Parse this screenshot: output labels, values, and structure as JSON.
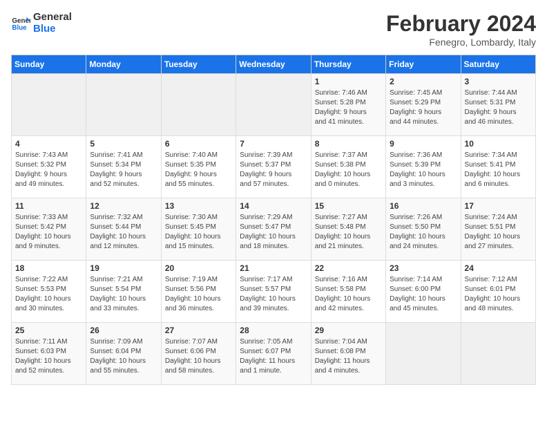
{
  "header": {
    "logo_line1": "General",
    "logo_line2": "Blue",
    "month": "February 2024",
    "location": "Fenegro, Lombardy, Italy"
  },
  "days_of_week": [
    "Sunday",
    "Monday",
    "Tuesday",
    "Wednesday",
    "Thursday",
    "Friday",
    "Saturday"
  ],
  "weeks": [
    [
      {
        "day": "",
        "info": ""
      },
      {
        "day": "",
        "info": ""
      },
      {
        "day": "",
        "info": ""
      },
      {
        "day": "",
        "info": ""
      },
      {
        "day": "1",
        "info": "Sunrise: 7:46 AM\nSunset: 5:28 PM\nDaylight: 9 hours\nand 41 minutes."
      },
      {
        "day": "2",
        "info": "Sunrise: 7:45 AM\nSunset: 5:29 PM\nDaylight: 9 hours\nand 44 minutes."
      },
      {
        "day": "3",
        "info": "Sunrise: 7:44 AM\nSunset: 5:31 PM\nDaylight: 9 hours\nand 46 minutes."
      }
    ],
    [
      {
        "day": "4",
        "info": "Sunrise: 7:43 AM\nSunset: 5:32 PM\nDaylight: 9 hours\nand 49 minutes."
      },
      {
        "day": "5",
        "info": "Sunrise: 7:41 AM\nSunset: 5:34 PM\nDaylight: 9 hours\nand 52 minutes."
      },
      {
        "day": "6",
        "info": "Sunrise: 7:40 AM\nSunset: 5:35 PM\nDaylight: 9 hours\nand 55 minutes."
      },
      {
        "day": "7",
        "info": "Sunrise: 7:39 AM\nSunset: 5:37 PM\nDaylight: 9 hours\nand 57 minutes."
      },
      {
        "day": "8",
        "info": "Sunrise: 7:37 AM\nSunset: 5:38 PM\nDaylight: 10 hours\nand 0 minutes."
      },
      {
        "day": "9",
        "info": "Sunrise: 7:36 AM\nSunset: 5:39 PM\nDaylight: 10 hours\nand 3 minutes."
      },
      {
        "day": "10",
        "info": "Sunrise: 7:34 AM\nSunset: 5:41 PM\nDaylight: 10 hours\nand 6 minutes."
      }
    ],
    [
      {
        "day": "11",
        "info": "Sunrise: 7:33 AM\nSunset: 5:42 PM\nDaylight: 10 hours\nand 9 minutes."
      },
      {
        "day": "12",
        "info": "Sunrise: 7:32 AM\nSunset: 5:44 PM\nDaylight: 10 hours\nand 12 minutes."
      },
      {
        "day": "13",
        "info": "Sunrise: 7:30 AM\nSunset: 5:45 PM\nDaylight: 10 hours\nand 15 minutes."
      },
      {
        "day": "14",
        "info": "Sunrise: 7:29 AM\nSunset: 5:47 PM\nDaylight: 10 hours\nand 18 minutes."
      },
      {
        "day": "15",
        "info": "Sunrise: 7:27 AM\nSunset: 5:48 PM\nDaylight: 10 hours\nand 21 minutes."
      },
      {
        "day": "16",
        "info": "Sunrise: 7:26 AM\nSunset: 5:50 PM\nDaylight: 10 hours\nand 24 minutes."
      },
      {
        "day": "17",
        "info": "Sunrise: 7:24 AM\nSunset: 5:51 PM\nDaylight: 10 hours\nand 27 minutes."
      }
    ],
    [
      {
        "day": "18",
        "info": "Sunrise: 7:22 AM\nSunset: 5:53 PM\nDaylight: 10 hours\nand 30 minutes."
      },
      {
        "day": "19",
        "info": "Sunrise: 7:21 AM\nSunset: 5:54 PM\nDaylight: 10 hours\nand 33 minutes."
      },
      {
        "day": "20",
        "info": "Sunrise: 7:19 AM\nSunset: 5:56 PM\nDaylight: 10 hours\nand 36 minutes."
      },
      {
        "day": "21",
        "info": "Sunrise: 7:17 AM\nSunset: 5:57 PM\nDaylight: 10 hours\nand 39 minutes."
      },
      {
        "day": "22",
        "info": "Sunrise: 7:16 AM\nSunset: 5:58 PM\nDaylight: 10 hours\nand 42 minutes."
      },
      {
        "day": "23",
        "info": "Sunrise: 7:14 AM\nSunset: 6:00 PM\nDaylight: 10 hours\nand 45 minutes."
      },
      {
        "day": "24",
        "info": "Sunrise: 7:12 AM\nSunset: 6:01 PM\nDaylight: 10 hours\nand 48 minutes."
      }
    ],
    [
      {
        "day": "25",
        "info": "Sunrise: 7:11 AM\nSunset: 6:03 PM\nDaylight: 10 hours\nand 52 minutes."
      },
      {
        "day": "26",
        "info": "Sunrise: 7:09 AM\nSunset: 6:04 PM\nDaylight: 10 hours\nand 55 minutes."
      },
      {
        "day": "27",
        "info": "Sunrise: 7:07 AM\nSunset: 6:06 PM\nDaylight: 10 hours\nand 58 minutes."
      },
      {
        "day": "28",
        "info": "Sunrise: 7:05 AM\nSunset: 6:07 PM\nDaylight: 11 hours\nand 1 minute."
      },
      {
        "day": "29",
        "info": "Sunrise: 7:04 AM\nSunset: 6:08 PM\nDaylight: 11 hours\nand 4 minutes."
      },
      {
        "day": "",
        "info": ""
      },
      {
        "day": "",
        "info": ""
      }
    ]
  ]
}
